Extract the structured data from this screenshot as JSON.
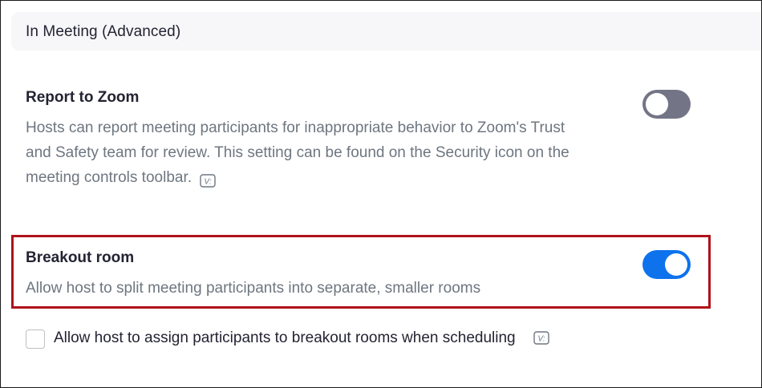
{
  "section": {
    "title": "In Meeting (Advanced)"
  },
  "report_to_zoom": {
    "title": "Report to Zoom",
    "desc_line1": "Hosts can report meeting participants for inappropriate behavior to Zoom's Trust",
    "desc_line2": "and Safety team for review. This setting can be found on the Security icon on the",
    "desc_line3": "meeting controls toolbar.",
    "enabled": false,
    "icon": "version-icon"
  },
  "breakout_room": {
    "title": "Breakout room",
    "desc": "Allow host to split meeting participants into separate, smaller rooms",
    "enabled": true,
    "highlight_color": "#b0121b"
  },
  "assign_option": {
    "label": "Allow host to assign participants to breakout rooms when scheduling",
    "checked": false,
    "icon": "version-icon"
  },
  "colors": {
    "toggle_on": "#0e72ed",
    "toggle_off": "#747487",
    "title_text": "#232333",
    "desc_text": "#6e7680"
  }
}
